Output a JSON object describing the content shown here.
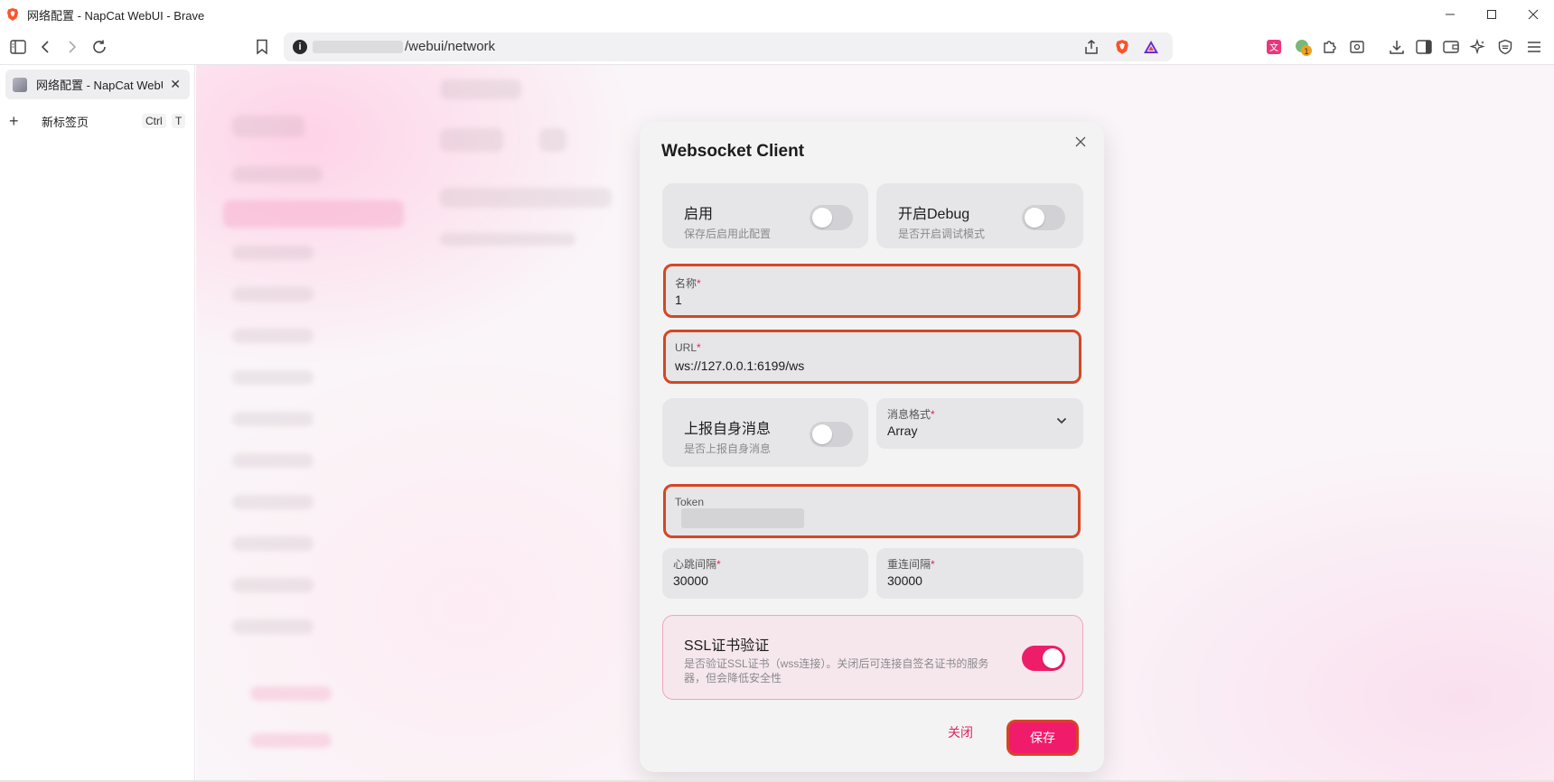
{
  "window": {
    "title": "网络配置 - NapCat WebUI - Brave"
  },
  "toolbar": {
    "url_path": "/webui/network"
  },
  "sidebar": {
    "tab_title": "网络配置 - NapCat WebUI",
    "new_tab_label": "新标签页",
    "new_tab_kbd_1": "Ctrl",
    "new_tab_kbd_2": "T"
  },
  "extensions": {
    "badge_count": "1"
  },
  "modal": {
    "title": "Websocket Client",
    "enable": {
      "label": "启用",
      "desc": "保存后启用此配置",
      "on": false
    },
    "debug": {
      "label": "开启Debug",
      "desc": "是否开启调试模式",
      "on": false
    },
    "name_field": {
      "label": "名称",
      "required_mark": "*",
      "value": "1"
    },
    "url_field": {
      "label": "URL",
      "required_mark": "*",
      "value": "ws://127.0.0.1:6199/ws"
    },
    "report_self": {
      "label": "上报自身消息",
      "desc": "是否上报自身消息",
      "on": false
    },
    "message_format": {
      "label": "消息格式",
      "required_mark": "*",
      "value": "Array"
    },
    "token_field": {
      "label": "Token"
    },
    "heartbeat": {
      "label": "心跳间隔",
      "required_mark": "*",
      "value": "30000"
    },
    "reconnect": {
      "label": "重连间隔",
      "required_mark": "*",
      "value": "30000"
    },
    "ssl": {
      "label": "SSL证书验证",
      "desc": "是否验证SSL证书（wss连接）。关闭后可连接自签名证书的服务器，但会降低安全性",
      "on": true
    },
    "close_label": "关闭",
    "save_label": "保存"
  },
  "colors": {
    "accent": "#f11b6b",
    "highlight_border": "#d54624"
  }
}
